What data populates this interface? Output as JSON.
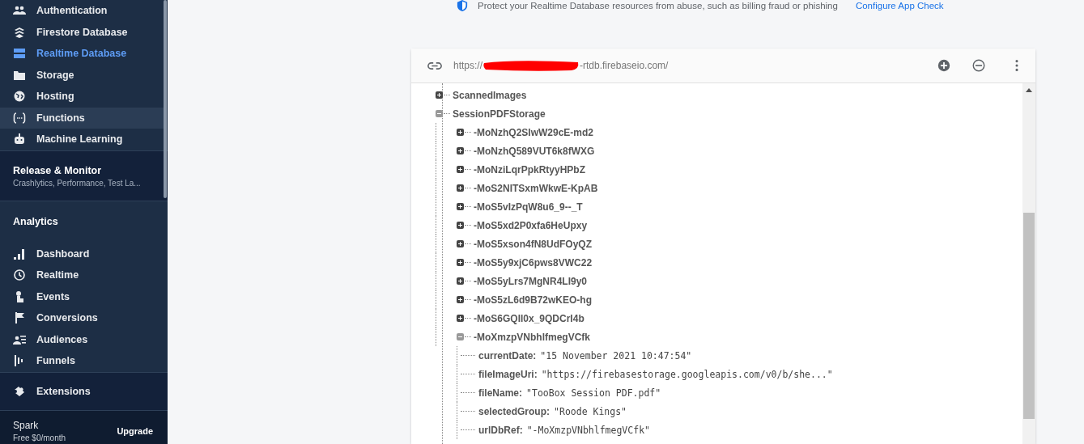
{
  "sidebar": {
    "sections": [
      {
        "kind": "plain",
        "items": [
          {
            "label": "Authentication",
            "selected": false,
            "highlighted": false
          },
          {
            "label": "Firestore Database",
            "selected": false,
            "highlighted": false
          },
          {
            "label": "Realtime Database",
            "selected": true,
            "highlighted": false
          },
          {
            "label": "Storage",
            "selected": false,
            "highlighted": false
          },
          {
            "label": "Hosting",
            "selected": false,
            "highlighted": false
          },
          {
            "label": "Functions",
            "selected": false,
            "highlighted": true
          },
          {
            "label": "Machine Learning",
            "selected": false,
            "highlighted": false
          }
        ]
      },
      {
        "kind": "collapsed",
        "title": "Release & Monitor",
        "subtitle": "Crashlytics, Performance, Test La..."
      },
      {
        "kind": "titled",
        "title": "Analytics",
        "items": [
          {
            "label": "Dashboard",
            "selected": false,
            "highlighted": false
          },
          {
            "label": "Realtime",
            "selected": false,
            "highlighted": false
          },
          {
            "label": "Events",
            "selected": false,
            "highlighted": false
          },
          {
            "label": "Conversions",
            "selected": false,
            "highlighted": false
          },
          {
            "label": "Audiences",
            "selected": false,
            "highlighted": false
          },
          {
            "label": "Funnels",
            "selected": false,
            "highlighted": false
          }
        ]
      },
      {
        "kind": "dark",
        "items": [
          {
            "label": "Extensions",
            "selected": false,
            "highlighted": false
          }
        ]
      }
    ],
    "plan": {
      "name": "Spark",
      "price": "Free $0/month",
      "action": "Upgrade"
    }
  },
  "banner": {
    "text": "Protect your Realtime Database resources from abuse, such as billing fraud or phishing",
    "link": "Configure App Check"
  },
  "database": {
    "url_start": "https://",
    "url_end": "-rtdb.firebaseio.com/",
    "tree": [
      {
        "key": "ScannedImages",
        "expanded": false
      },
      {
        "key": "SessionPDFStorage",
        "expanded": true,
        "children": [
          {
            "key": "-MoNzhQ2SIwW29cE-md2",
            "expanded": false
          },
          {
            "key": "-MoNzhQ589VUT6k8fWXG",
            "expanded": false
          },
          {
            "key": "-MoNziLqrPpkRtyyHPbZ",
            "expanded": false
          },
          {
            "key": "-MoS2NITSxmWkwE-KpAB",
            "expanded": false
          },
          {
            "key": "-MoS5vIzPqW8u6_9--_T",
            "expanded": false
          },
          {
            "key": "-MoS5xd2P0xfa6HeUpxy",
            "expanded": false
          },
          {
            "key": "-MoS5xson4fN8UdFOyQZ",
            "expanded": false
          },
          {
            "key": "-MoS5y9xjC6pws8VWC22",
            "expanded": false
          },
          {
            "key": "-MoS5yLrs7MgNR4LI9y0",
            "expanded": false
          },
          {
            "key": "-MoS5zL6d9B72wKEO-hg",
            "expanded": false
          },
          {
            "key": "-MoS6GQIl0x_9QDCrI4b",
            "expanded": false
          },
          {
            "key": "-MoXmzpVNbhlfmegVCfk",
            "expanded": true,
            "children": [
              {
                "key": "currentDate:",
                "value": "\"15 November 2021 10:47:54\""
              },
              {
                "key": "fileImageUri:",
                "value": "\"https://firebasestorage.googleapis.com/v0/b/she...\""
              },
              {
                "key": "fileName:",
                "value": "\"TooBox Session PDF.pdf\""
              },
              {
                "key": "selectedGroup:",
                "value": "\"Roode Kings\""
              },
              {
                "key": "urlDbRef:",
                "value": "\"-MoXmzpVNbhlfmegVCfk\""
              }
            ]
          }
        ]
      }
    ]
  }
}
